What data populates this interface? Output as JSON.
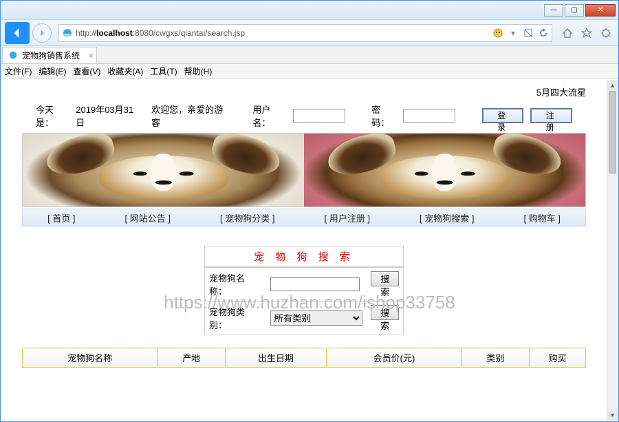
{
  "window": {
    "tab_title": "宠物狗销售系统",
    "url_plain_prefix": "http://",
    "url_host": "localhost",
    "url_rest": ":8080/cwgxs/qiantai/search.jsp"
  },
  "menubar": {
    "file": "文件(F)",
    "edit": "编辑(E)",
    "view": "查看(V)",
    "favorites": "收藏夹(A)",
    "tools": "工具(T)",
    "help": "帮助(H)"
  },
  "page": {
    "marquee": "5月四大流星",
    "today_label": "今天是：",
    "today_value": "2019年03月31日",
    "welcome": "欢迎您，亲爱的游客",
    "username_label": "用户名：",
    "password_label": "密码：",
    "login_btn": "登 录",
    "register_btn": "注 册"
  },
  "nav": {
    "home": "[ 首页 ]",
    "notice": "[ 网站公告 ]",
    "category": "[ 宠物狗分类 ]",
    "userreg": "[ 用户注册 ]",
    "search": "[ 宠物狗搜索 ]",
    "cart": "[ 购物车 ]"
  },
  "watermark": "https://www.huzhan.com/ishop33758",
  "searchbox": {
    "title": "宠 物 狗 搜 索",
    "name_label": "宠物狗名称：",
    "cat_label": "宠物狗类别：",
    "cat_value": "所有类别",
    "btn": "搜索"
  },
  "table": {
    "col_name": "宠物狗名称",
    "col_origin": "产地",
    "col_birth": "出生日期",
    "col_price": "会员价(元)",
    "col_cat": "类别",
    "col_buy": "购买"
  }
}
